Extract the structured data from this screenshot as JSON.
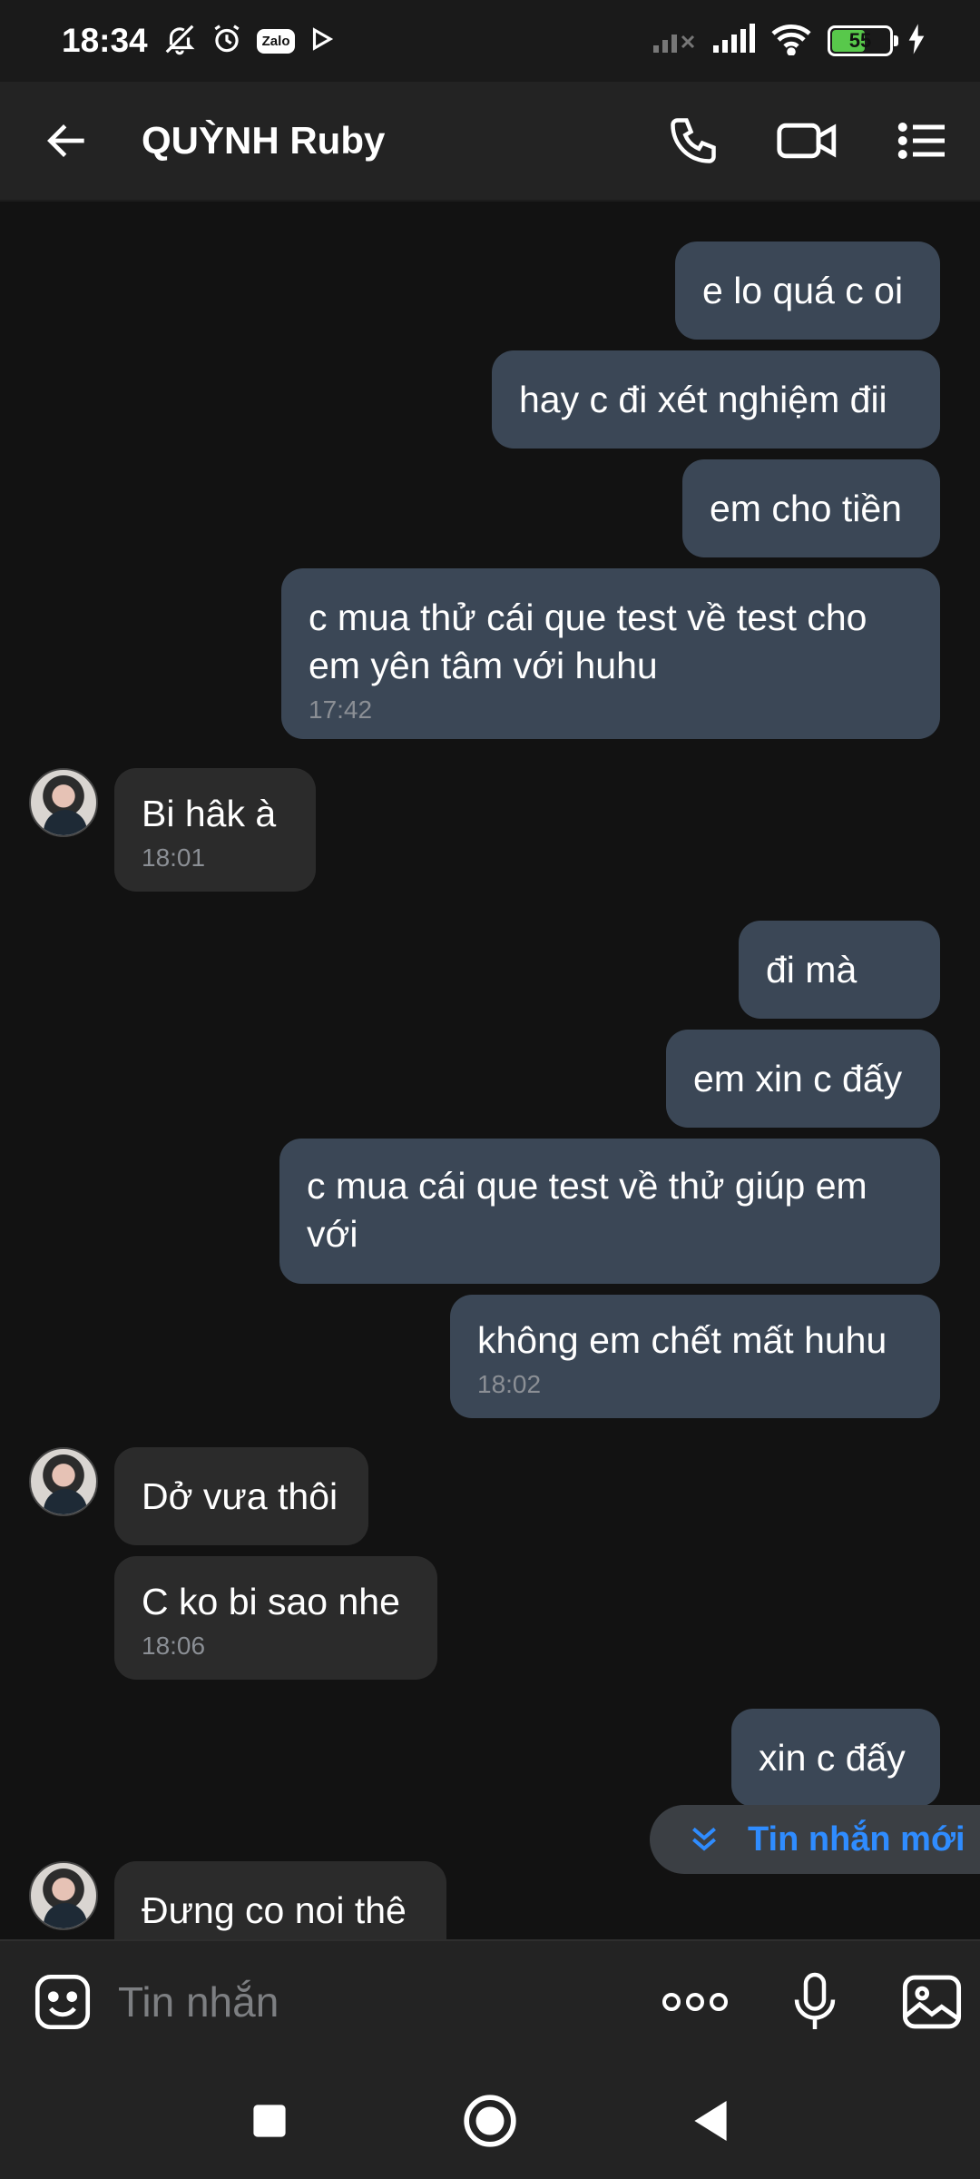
{
  "status_bar": {
    "time": "18:34",
    "zalo_label": "Zalo",
    "battery_level": "55",
    "icons": [
      "bell-off-icon",
      "alarm-icon",
      "zalo-icon",
      "play-icon",
      "signal-weak-icon",
      "signal-icon",
      "wifi-icon",
      "battery-icon",
      "charging-icon"
    ]
  },
  "header": {
    "contact_name": "QUỲNH Ruby",
    "icons": [
      "back-arrow-icon",
      "phone-icon",
      "video-call-icon",
      "menu-list-icon"
    ]
  },
  "messages": [
    {
      "dir": "out",
      "text": "e lo quá c oi",
      "time": ""
    },
    {
      "dir": "out",
      "text": "hay c đi xét nghiệm đii",
      "time": ""
    },
    {
      "dir": "out",
      "text": "em cho tiền",
      "time": ""
    },
    {
      "dir": "out",
      "text": "c mua thử cái que test về test cho em yên tâm với huhu",
      "time": "17:42"
    },
    {
      "dir": "in",
      "text": "Bi hâk à",
      "time": "18:01"
    },
    {
      "dir": "out",
      "text": "đi mà",
      "time": ""
    },
    {
      "dir": "out",
      "text": "em xin c đấy",
      "time": ""
    },
    {
      "dir": "out",
      "text": "c mua cái que test về thử giúp em với",
      "time": ""
    },
    {
      "dir": "out",
      "text": "không em chết mất huhu",
      "time": "18:02"
    },
    {
      "dir": "in",
      "text": "Dở vưa thôi",
      "time": ""
    },
    {
      "dir": "in",
      "text": "C ko bi sao nhe",
      "time": "18:06"
    },
    {
      "dir": "out",
      "text": "xin c đấy",
      "time": ""
    },
    {
      "dir": "in",
      "text": "Đưng co noi thê",
      "time": ""
    }
  ],
  "new_messages_pill": {
    "label": "Tin nhắn mới",
    "icon": "double-chevron-down-icon"
  },
  "input_bar": {
    "placeholder": "Tin nhắn",
    "icons": [
      "sticker-icon",
      "more-dots-icon",
      "microphone-icon",
      "image-icon"
    ]
  },
  "nav_bar": {
    "icons": [
      "recents-square-icon",
      "home-circle-icon",
      "back-triangle-icon"
    ]
  },
  "colors": {
    "background": "#121212",
    "header": "#232323",
    "outgoing_bubble": "#3b4756",
    "incoming_bubble": "#2b2b2b",
    "accent": "#2f8cff",
    "timestamp": "#8b8f95"
  }
}
